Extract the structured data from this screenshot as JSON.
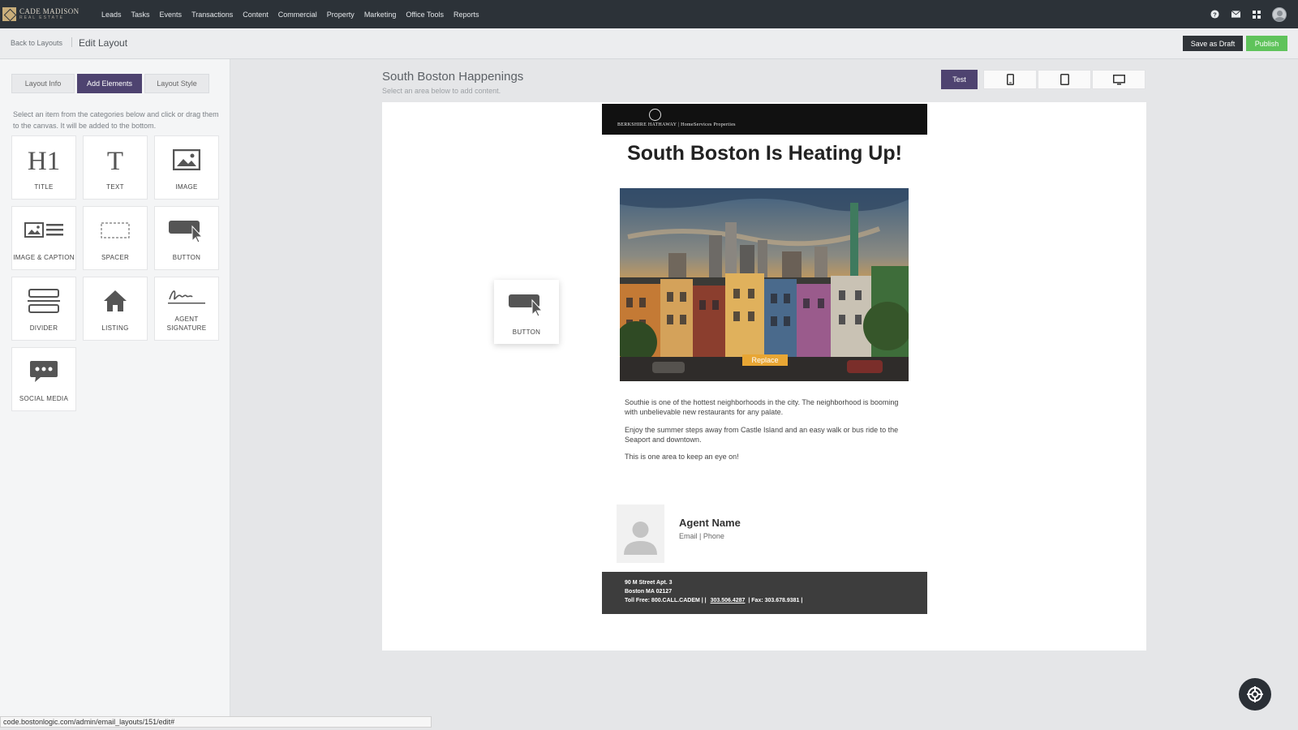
{
  "brand": {
    "name": "CADE MADISON",
    "sub": "REAL ESTATE"
  },
  "nav": {
    "items": [
      "Leads",
      "Tasks",
      "Events",
      "Transactions",
      "Content",
      "Commercial",
      "Property",
      "Marketing",
      "Office Tools",
      "Reports"
    ]
  },
  "subheader": {
    "back_label": "Back to Layouts",
    "title": "Edit Layout",
    "draft_label": "Save as Draft",
    "publish_label": "Publish"
  },
  "panel": {
    "tabs": [
      {
        "label": "Layout Info",
        "active": false
      },
      {
        "label": "Add Elements",
        "active": true
      },
      {
        "label": "Layout Style",
        "active": false
      }
    ],
    "instructions": "Select an item from the categories below and click or drag them to the canvas. It will be added to the bottom.",
    "elements": [
      {
        "label": "TITLE",
        "icon": "title-icon"
      },
      {
        "label": "TEXT",
        "icon": "text-icon"
      },
      {
        "label": "IMAGE",
        "icon": "image-icon"
      },
      {
        "label": "IMAGE & CAPTION",
        "icon": "image-caption-icon"
      },
      {
        "label": "SPACER",
        "icon": "spacer-icon"
      },
      {
        "label": "BUTTON",
        "icon": "button-icon"
      },
      {
        "label": "DIVIDER",
        "icon": "divider-icon"
      },
      {
        "label": "LISTING",
        "icon": "house-icon"
      },
      {
        "label": "AGENT SIGNATURE",
        "icon": "signature-icon"
      },
      {
        "label": "SOCIAL MEDIA",
        "icon": "chat-icon"
      }
    ]
  },
  "canvas": {
    "title": "South Boston Happenings",
    "subtitle": "Select an area below to add content.",
    "test_label": "Test",
    "devices": [
      "phone-icon",
      "tablet-icon",
      "desktop-icon"
    ]
  },
  "email": {
    "header_logo": "BERKSHIRE HATHAWAY | HomeServices Properties",
    "headline": "South Boston Is Heating Up!",
    "replace_label": "Replace",
    "paragraphs": [
      "Southie is one of the hottest neighborhoods in the city. The neighborhood is booming with unbelievable new restaurants for any palate.",
      "Enjoy the summer steps away from Castle Island and an easy walk or bus ride to the Seaport and downtown.",
      "This is one area to keep an eye on!"
    ],
    "agent": {
      "name": "Agent Name",
      "contact": "Email | Phone"
    },
    "footer": {
      "address1": "90 M Street Apt. 3",
      "address2": "Boston MA 02127",
      "tollfree": "Toll Free: 800.CALL.CADEM |  |",
      "phone": "303.506.4287",
      "fax": "|  Fax: 303.678.9381  |"
    }
  },
  "drag_card": {
    "label": "BUTTON"
  },
  "status_url": "code.bostonlogic.com/admin/email_layouts/151/edit#",
  "colors": {
    "accent": "#4e4370",
    "publish": "#5fc35b",
    "replace": "#e8a634",
    "nav_bg": "#2c3238"
  }
}
